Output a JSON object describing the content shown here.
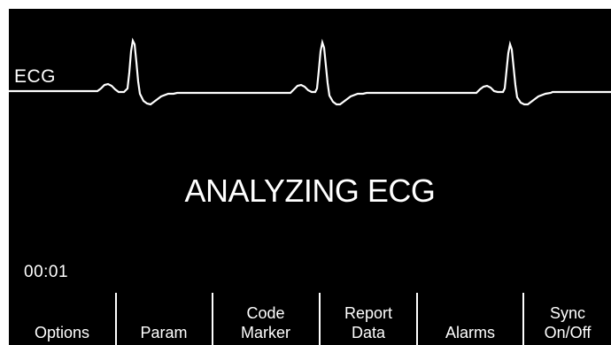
{
  "waveform": {
    "label": "ECG",
    "color": "#ffffff"
  },
  "status": {
    "message": "ANALYZING ECG"
  },
  "timer": {
    "elapsed": "00:01"
  },
  "softkeys": [
    {
      "label": "Options"
    },
    {
      "label": "Param"
    },
    {
      "label": "Code\nMarker"
    },
    {
      "label": "Report\nData"
    },
    {
      "label": "Alarms"
    },
    {
      "label": "Sync\nOn/Off"
    }
  ],
  "colors": {
    "background": "#000000",
    "foreground": "#ffffff"
  }
}
